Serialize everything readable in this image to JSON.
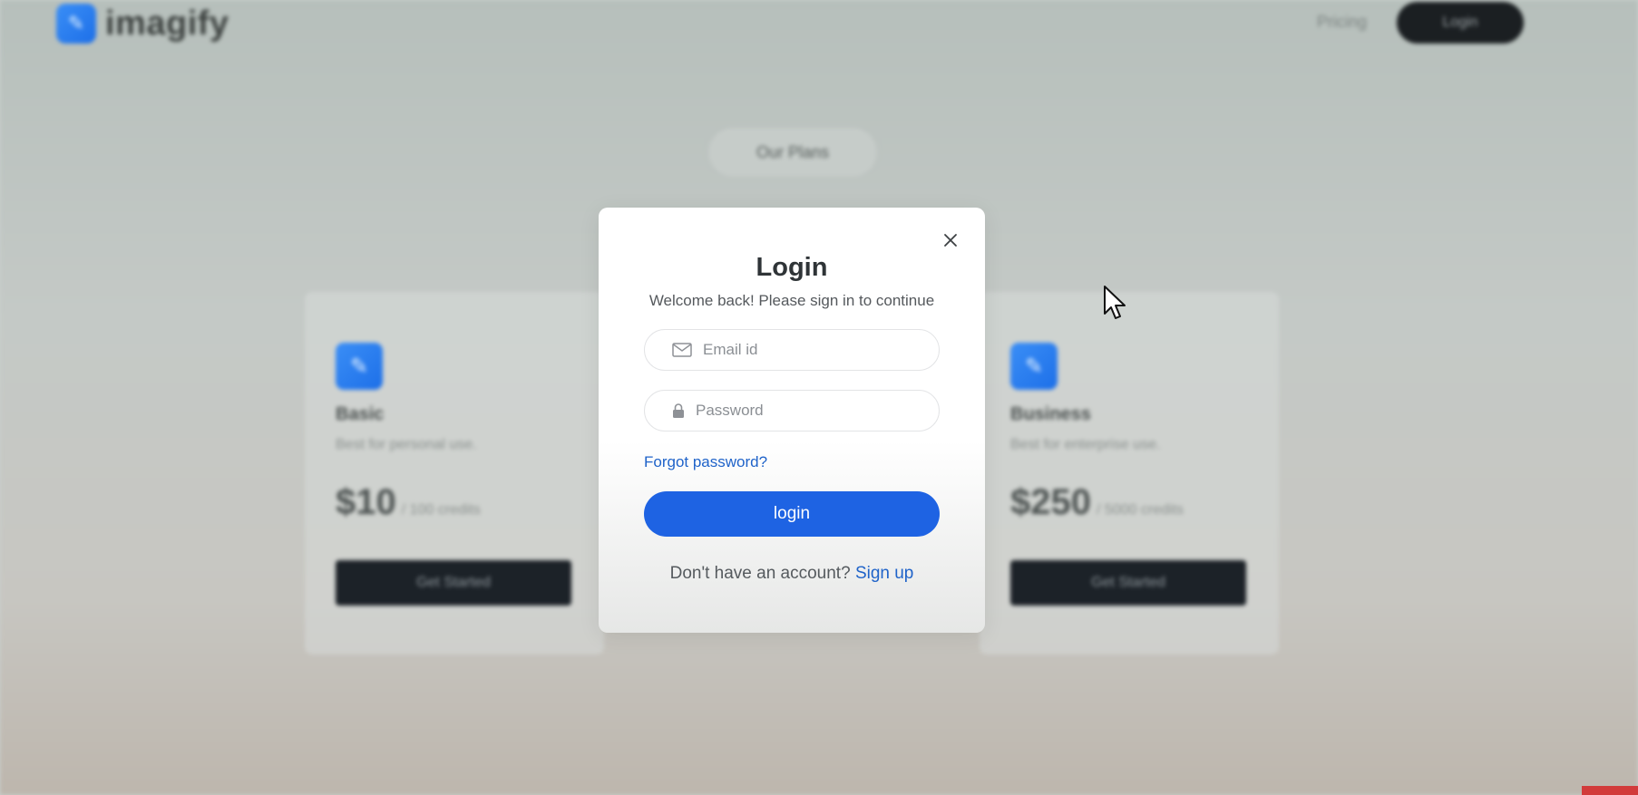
{
  "background": {
    "brand": {
      "name": "imagify"
    },
    "nav": {
      "pricing_label": "Pricing",
      "login_label": "Login"
    },
    "section_pill": "Our Plans",
    "plans": [
      {
        "name": "Basic",
        "desc": "Best for personal use.",
        "price": "$10",
        "credits": "/ 100 credits",
        "button": "Get Started"
      },
      {
        "name": "Business",
        "desc": "Best for enterprise use.",
        "price": "$250",
        "credits": "/ 5000 credits",
        "button": "Get Started"
      }
    ]
  },
  "modal": {
    "title": "Login",
    "subtitle": "Welcome back! Please sign in to continue",
    "email": {
      "placeholder": "Email id",
      "icon": "mail-icon"
    },
    "password": {
      "placeholder": "Password",
      "icon": "lock-icon"
    },
    "forgot_label": "Forgot password?",
    "submit_label": "login",
    "signup_prompt": "Don't have an account?",
    "signup_link": "Sign up",
    "close_icon": "close-icon"
  },
  "colors": {
    "accent": "#1e63e3",
    "link": "#1f63c9",
    "brand_blue": "#2a7ff0"
  }
}
